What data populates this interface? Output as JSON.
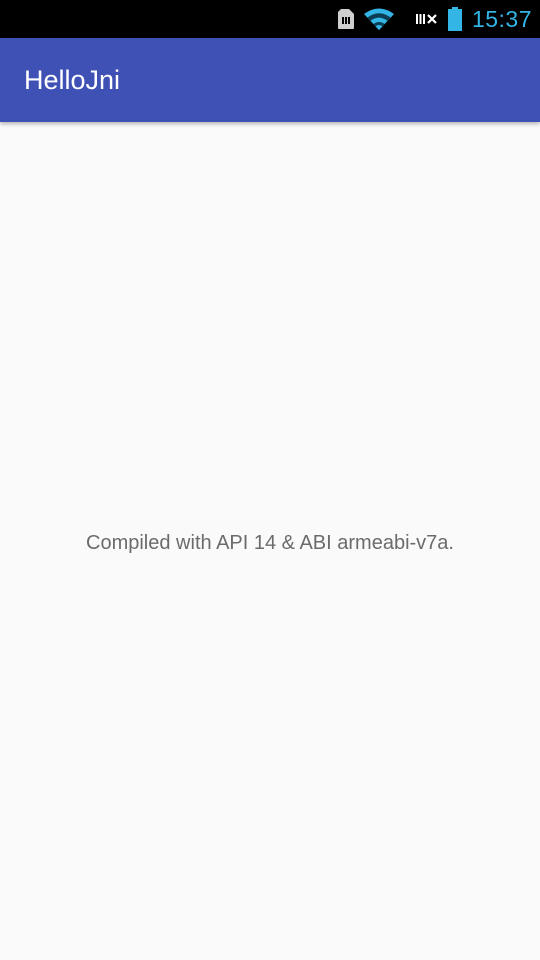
{
  "status_bar": {
    "time": "15:37",
    "icons": [
      "sim-card-icon",
      "wifi-icon",
      "no-data-icon",
      "battery-icon"
    ],
    "time_color": "#33b5e5"
  },
  "app_bar": {
    "title": "HelloJni",
    "color": "#3f51b5"
  },
  "main": {
    "message": "Compiled with API 14 & ABI armeabi-v7a."
  }
}
